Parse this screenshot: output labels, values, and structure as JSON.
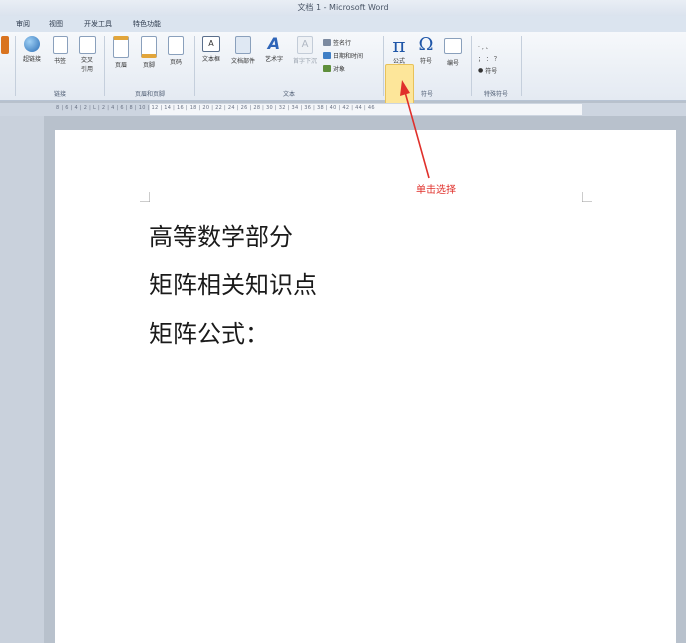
{
  "window": {
    "title": "文档 1 - Microsoft Word"
  },
  "tabs": [
    "审阅",
    "视图",
    "开发工具",
    "特色功能"
  ],
  "groups": {
    "links": {
      "label": "链接",
      "buttons": [
        "超链接",
        "书签",
        "交叉引用"
      ]
    },
    "header_footer": {
      "label": "页眉和页脚",
      "buttons": [
        "页眉",
        "页脚",
        "页码"
      ]
    },
    "text": {
      "label": "文本",
      "buttons": [
        "文本框",
        "文档部件",
        "艺术字",
        "首字下沉"
      ],
      "small": [
        "签名行",
        "日期和时间",
        "对象"
      ]
    },
    "symbols": {
      "label": "符号",
      "buttons": [
        "公式",
        "符号",
        "编号"
      ]
    },
    "special": {
      "label": "特殊符号",
      "small": [
        "符号"
      ]
    }
  },
  "ruler": {
    "text": "8 | 6 | 4 | 2 | L | 2 | 4 | 6 | 8 | 10 | 12 | 14 | 16 | 18 | 20 | 22 | 24 | 26 | 28 | 30 | 32 | 34 | 36 | 38 | 40 | 42 | 44 | 46"
  },
  "document": {
    "lines": [
      "高等数学部分",
      "矩阵相关知识点",
      "矩阵公式："
    ]
  },
  "annotation": {
    "text": "单击选择"
  },
  "colors": {
    "accent_highlight": "#fde69a",
    "annotation": "#e0302b",
    "page": "#ffffff"
  }
}
